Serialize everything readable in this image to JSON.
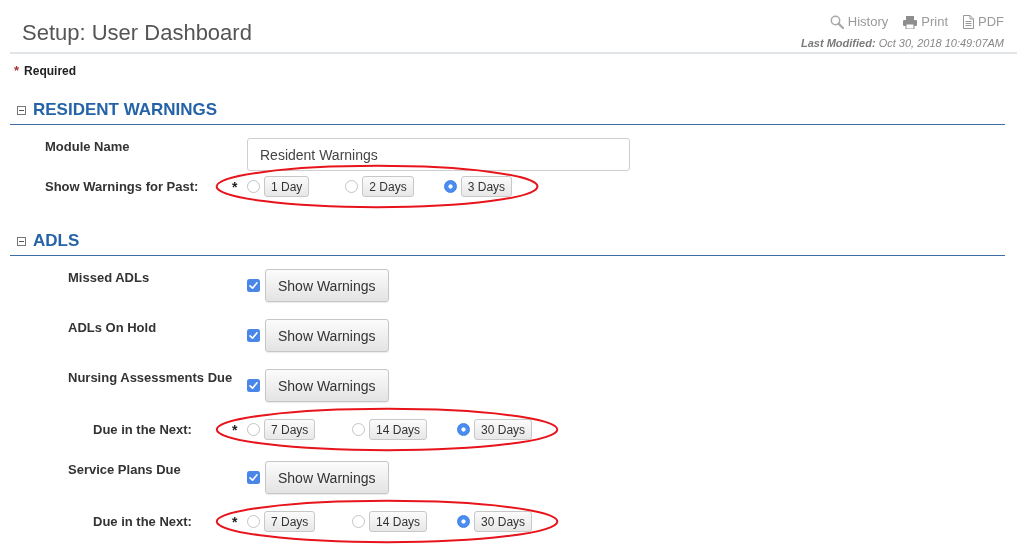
{
  "header": {
    "title": "Setup: User Dashboard",
    "actions": [
      {
        "kind": "history",
        "label": "History"
      },
      {
        "kind": "print",
        "label": "Print"
      },
      {
        "kind": "pdf",
        "label": "PDF"
      }
    ],
    "last_modified": "**Last Modified:** Oct 30, 2018 10:49:07AM"
  },
  "required_note": {
    "marker": "*",
    "label": "Required"
  },
  "sections": [
    {
      "title": "RESIDENT WARNINGS",
      "expanded": true,
      "rows": [
        {
          "kind": "text",
          "label": "Module Name",
          "value": "Resident Warnings"
        },
        {
          "kind": "radio",
          "label": "Show Warnings for Past:",
          "marker": "*",
          "highlighted": true,
          "options": [
            {
              "label": "1 Day",
              "selected": false
            },
            {
              "label": "2 Days",
              "selected": false
            },
            {
              "label": "3 Days",
              "selected": true
            }
          ]
        }
      ]
    },
    {
      "title": "ADLS",
      "expanded": true,
      "rows": [
        {
          "kind": "toggle",
          "label": "Missed ADLs",
          "checked": true,
          "button": "Show Warnings"
        },
        {
          "kind": "toggle",
          "label": "ADLs On Hold",
          "checked": true,
          "button": "Show Warnings"
        },
        {
          "kind": "toggle",
          "label": "Nursing Assessments Due",
          "checked": true,
          "button": "Show Warnings",
          "children": [
            {
              "kind": "radio",
              "label": "Due in the Next:",
              "marker": "*",
              "highlighted": true,
              "options": [
                {
                  "label": "7 Days",
                  "selected": false
                },
                {
                  "label": "14 Days",
                  "selected": false
                },
                {
                  "label": "30 Days",
                  "selected": true
                }
              ]
            }
          ]
        },
        {
          "kind": "toggle",
          "label": "Service Plans Due",
          "checked": true,
          "button": "Show Warnings",
          "children": [
            {
              "kind": "radio",
              "label": "Due in the Next:",
              "marker": "*",
              "highlighted": true,
              "options": [
                {
                  "label": "7 Days",
                  "selected": false
                },
                {
                  "label": "14 Days",
                  "selected": false
                },
                {
                  "label": "30 Days",
                  "selected": true
                }
              ]
            }
          ]
        }
      ]
    }
  ]
}
